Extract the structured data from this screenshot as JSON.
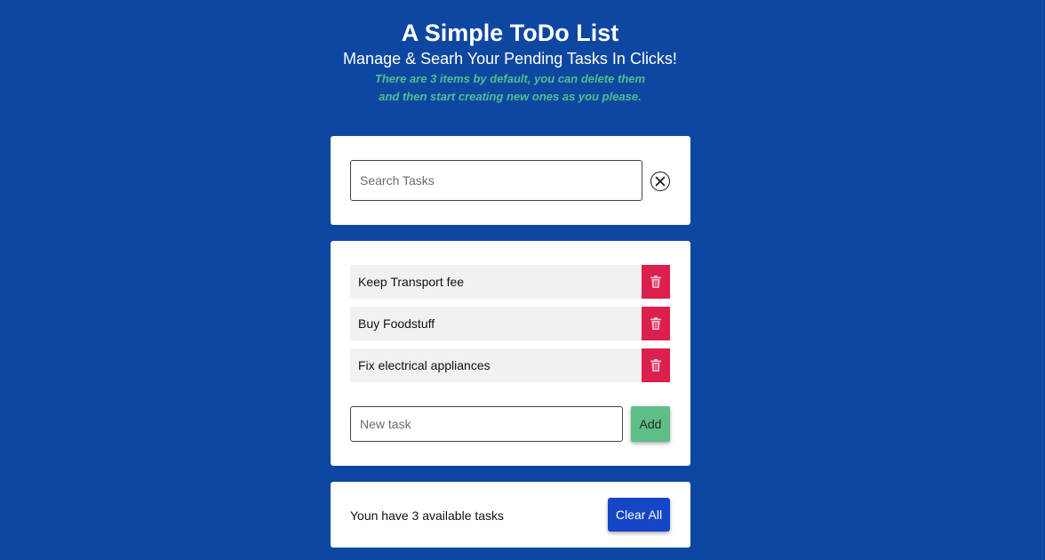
{
  "header": {
    "title": "A Simple ToDo List",
    "subtitle": "Manage & Searh Your Pending Tasks In Clicks!",
    "note_line1": "There are 3 items by default, you can delete them",
    "note_line2": "and then start creating new ones as you please."
  },
  "search": {
    "placeholder": "Search Tasks",
    "value": "",
    "clear_icon": "close-circle-icon"
  },
  "tasks": [
    {
      "text": "Keep Transport fee"
    },
    {
      "text": "Buy Foodstuff"
    },
    {
      "text": "Fix electrical appliances"
    }
  ],
  "new_task": {
    "placeholder": "New task",
    "value": "",
    "add_label": "Add"
  },
  "footer": {
    "count_text": "Youn have 3 available tasks",
    "clear_all_label": "Clear All"
  },
  "colors": {
    "background": "#0d47a1",
    "note": "#4fc08d",
    "delete": "#dc1f4d",
    "add": "#5fbe88",
    "clear_all": "#1546c7"
  },
  "icons": {
    "delete": "trash-icon"
  }
}
